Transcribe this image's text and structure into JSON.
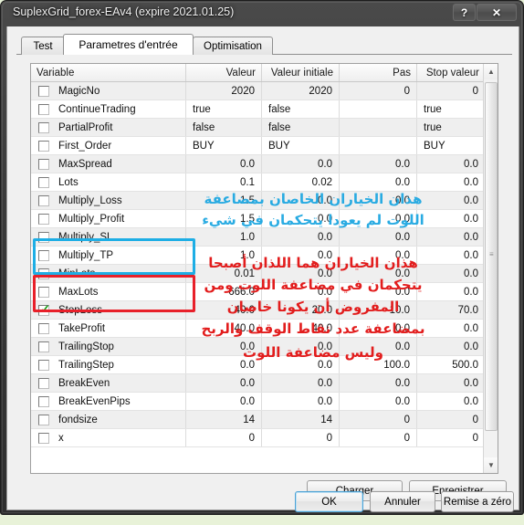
{
  "window": {
    "title": "SuplexGrid_forex-EAv4 (expire 2021.01.25)",
    "buttons": {
      "help": "?",
      "close": "✕"
    }
  },
  "tabs": [
    {
      "label": "Test",
      "active": false
    },
    {
      "label": "Parametres d'entrée",
      "active": true
    },
    {
      "label": "Optimisation",
      "active": false
    }
  ],
  "grid": {
    "columns": [
      "Variable",
      "Valeur",
      "Valeur initiale",
      "Pas",
      "Stop valeur"
    ],
    "rows": [
      {
        "name": "MagicNo",
        "checked": false,
        "valeur": "2020",
        "initiale": "2020",
        "pas": "0",
        "stop": "0",
        "align": "r"
      },
      {
        "name": "ContinueTrading",
        "checked": false,
        "valeur": "true",
        "initiale": "false",
        "pas": "",
        "stop": "true",
        "align": "l"
      },
      {
        "name": "PartialProfit",
        "checked": false,
        "valeur": "false",
        "initiale": "false",
        "pas": "",
        "stop": "true",
        "align": "l"
      },
      {
        "name": "First_Order",
        "checked": false,
        "valeur": "BUY",
        "initiale": "BUY",
        "pas": "",
        "stop": "BUY",
        "align": "l"
      },
      {
        "name": "MaxSpread",
        "checked": false,
        "valeur": "0.0",
        "initiale": "0.0",
        "pas": "0.0",
        "stop": "0.0",
        "align": "r"
      },
      {
        "name": "Lots",
        "checked": false,
        "valeur": "0.1",
        "initiale": "0.02",
        "pas": "0.0",
        "stop": "0.0",
        "align": "r"
      },
      {
        "name": "Multiply_Loss",
        "checked": false,
        "valeur": "1.5",
        "initiale": "0.0",
        "pas": "0.0",
        "stop": "0.0",
        "align": "r"
      },
      {
        "name": "Multiply_Profit",
        "checked": false,
        "valeur": "1.5",
        "initiale": "0.0",
        "pas": "0.0",
        "stop": "0.0",
        "align": "r"
      },
      {
        "name": "Multiply_SL",
        "checked": false,
        "valeur": "1.0",
        "initiale": "0.0",
        "pas": "0.0",
        "stop": "0.0",
        "align": "r"
      },
      {
        "name": "Multiply_TP",
        "checked": false,
        "valeur": "1.0",
        "initiale": "0.0",
        "pas": "0.0",
        "stop": "0.0",
        "align": "r"
      },
      {
        "name": "MinLots",
        "checked": false,
        "valeur": "0.01",
        "initiale": "0.0",
        "pas": "0.0",
        "stop": "0.0",
        "align": "r"
      },
      {
        "name": "MaxLots",
        "checked": false,
        "valeur": "666.0",
        "initiale": "0.0",
        "pas": "0.0",
        "stop": "0.0",
        "align": "r"
      },
      {
        "name": "StopLoss",
        "checked": true,
        "valeur": "40.0",
        "initiale": "20.0",
        "pas": "10.0",
        "stop": "70.0",
        "align": "r"
      },
      {
        "name": "TakeProfit",
        "checked": false,
        "valeur": "40.0",
        "initiale": "40.0",
        "pas": "0.0",
        "stop": "0.0",
        "align": "r"
      },
      {
        "name": "TrailingStop",
        "checked": false,
        "valeur": "0.0",
        "initiale": "0.0",
        "pas": "0.0",
        "stop": "0.0",
        "align": "r"
      },
      {
        "name": "TrailingStep",
        "checked": false,
        "valeur": "0.0",
        "initiale": "0.0",
        "pas": "100.0",
        "stop": "500.0",
        "align": "r"
      },
      {
        "name": "BreakEven",
        "checked": false,
        "valeur": "0.0",
        "initiale": "0.0",
        "pas": "0.0",
        "stop": "0.0",
        "align": "r"
      },
      {
        "name": "BreakEvenPips",
        "checked": false,
        "valeur": "0.0",
        "initiale": "0.0",
        "pas": "0.0",
        "stop": "0.0",
        "align": "r"
      },
      {
        "name": "fondsize",
        "checked": false,
        "valeur": "14",
        "initiale": "14",
        "pas": "0",
        "stop": "0",
        "align": "r"
      },
      {
        "name": "x",
        "checked": false,
        "valeur": "0",
        "initiale": "0",
        "pas": "0",
        "stop": "0",
        "align": "r"
      }
    ]
  },
  "annotations": {
    "cyan": {
      "color": "#29abe2",
      "line1": "هذان الخياران الخاصان بمضاعفة",
      "line2": "اللوت لم يعودا يتحكمان في شيء"
    },
    "red": {
      "color": "#e21d1d",
      "line1": "هذان الخياران هما اللذان أصبحا",
      "line2": "يتحكمان في مضاعفة اللوت ومن",
      "line3": "المفروض أن يكونا خاصان",
      "line4": "بمضاعفة عدد نقاط الوقف والربح",
      "line5": "وليس مضاعفة اللوت"
    },
    "boxes": {
      "cyan_box_color": "#1eaee5",
      "red_box_color": "#e8202a"
    }
  },
  "footer": {
    "charger": "Charger",
    "enregistrer": "Enregistrer",
    "ok": "OK",
    "annuler": "Annuler",
    "reset": "Remise a zéro"
  }
}
